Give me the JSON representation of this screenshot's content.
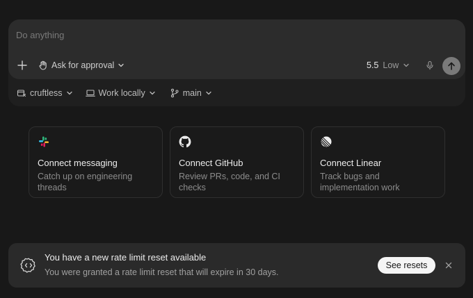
{
  "composer": {
    "placeholder": "Do anything",
    "approval_label": "Ask for approval",
    "model_version": "5.5",
    "model_effort": "Low"
  },
  "footer": {
    "repo": "cruftless",
    "environment": "Work locally",
    "branch": "main"
  },
  "cards": [
    {
      "title": "Connect messaging",
      "desc_line1": "Catch up on engineering",
      "desc_line2": "threads",
      "icon": "slack-icon"
    },
    {
      "title": "Connect GitHub",
      "desc_line1": "Review PRs, code, and CI",
      "desc_line2": "checks",
      "icon": "github-icon"
    },
    {
      "title": "Connect Linear",
      "desc_line1": "Track bugs and",
      "desc_line2": "implementation work",
      "icon": "linear-icon"
    }
  ],
  "banner": {
    "title": "You have a new rate limit reset available",
    "desc": "You were granted a rate limit reset that will expire in 30 days.",
    "button": "See resets"
  },
  "colors": {
    "background": "#181818",
    "composer": "#2c2c2c",
    "banner": "#2a2a2a",
    "send_button": "#7a7a7a"
  }
}
